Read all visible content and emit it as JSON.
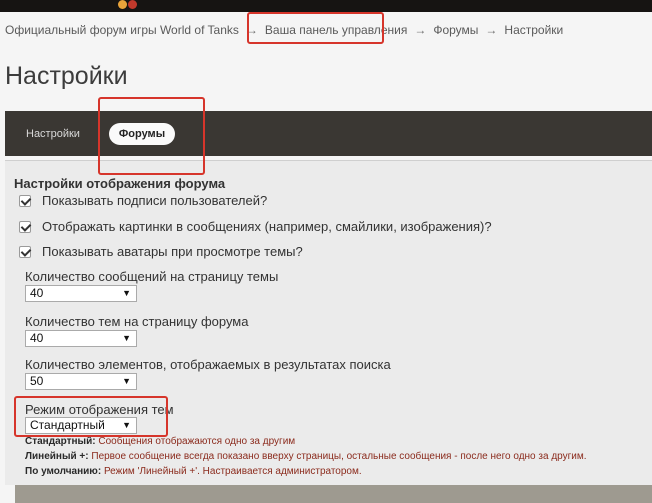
{
  "breadcrumb": {
    "items": [
      "Официальный форум игры World of Tanks",
      "Ваша панель управления",
      "Форумы",
      "Настройки"
    ],
    "separator": "→"
  },
  "page": {
    "title": "Настройки"
  },
  "tabs": [
    "Настройки",
    "Форумы"
  ],
  "active_tab": "Форумы",
  "section": {
    "title": "Настройки отображения форума",
    "checkboxes": [
      {
        "label": "Показывать подписи пользователей?",
        "checked": true
      },
      {
        "label": "Отображать картинки в сообщениях (например, смайлики, изображения)?",
        "checked": true
      },
      {
        "label": "Показывать аватары при просмотре темы?",
        "checked": true
      }
    ],
    "fields": [
      {
        "label": "Количество сообщений на страницу темы",
        "value": "40"
      },
      {
        "label": "Количество тем на страницу форума",
        "value": "40"
      },
      {
        "label": "Количество элементов, отображаемых в результатах поиска",
        "value": "50"
      },
      {
        "label": "Режим отображения тем",
        "value": "Стандартный"
      }
    ],
    "descriptions": [
      {
        "term": "Стандартный:",
        "text": "Сообщения отображаются одно за другим"
      },
      {
        "term": "Линейный +:",
        "text": "Первое сообщение всегда показано вверху страницы, остальные сообщения - после него одно за другим."
      },
      {
        "term": "По умолчанию:",
        "text": "Режим 'Линейный +'. Настраивается администратором."
      }
    ]
  },
  "colors": {
    "highlight": "#d6352b",
    "tab_bar": "#3a3733",
    "accent_text": "#8b2b1d"
  }
}
